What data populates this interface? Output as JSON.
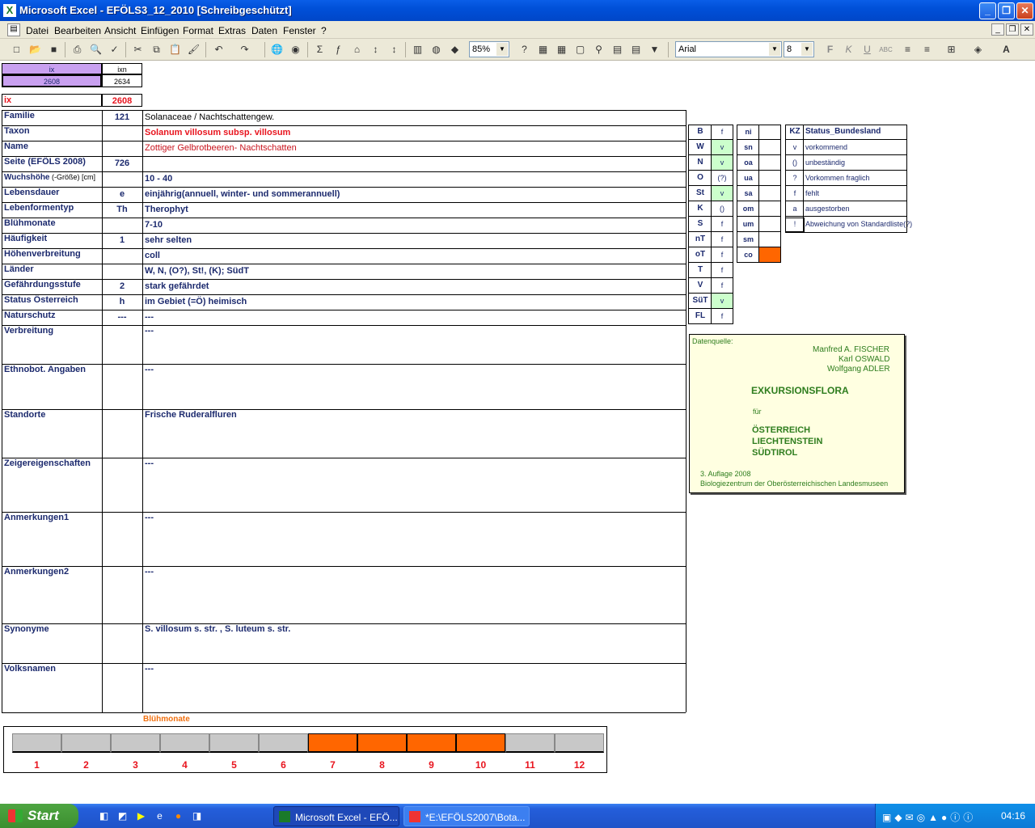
{
  "window": {
    "title": "Microsoft Excel - EFÖLS3_12_2010  [Schreibgeschützt]"
  },
  "menu": [
    "Datei",
    "Bearbeiten",
    "Ansicht",
    "Einfügen",
    "Format",
    "Extras",
    "Daten",
    "Fenster",
    "?"
  ],
  "toolbar": {
    "zoom": "85%",
    "font": "Arial",
    "size": "8"
  },
  "header_cells": {
    "ix_label": "ix",
    "ixn_label": "ixn",
    "ix_value": "2608",
    "ixn_value": "2634",
    "ix2_label": "ix",
    "ix2_value": "2608"
  },
  "rows": [
    {
      "label": "Familie",
      "code": "121",
      "value": "Solanaceae  /  Nachtschattengew."
    },
    {
      "label": "Taxon",
      "code": "",
      "value": "Solanum villosum subsp. villosum"
    },
    {
      "label": "Name",
      "code": "",
      "value": "Zottiger Gelbrotbeeren- Nachtschatten"
    },
    {
      "label": "Seite (EFÖLS 2008)",
      "code": "726",
      "value": ""
    },
    {
      "label": "Wuchshöhe",
      "label_suffix": "(-Größe) [cm]",
      "code": "",
      "value": " 10 - 40"
    },
    {
      "label": "Lebensdauer",
      "code": "e",
      "value": "einjährig(annuell, winter- und sommerannuell)"
    },
    {
      "label": "Lebenformentyp",
      "code": "Th",
      "value": "Therophyt"
    },
    {
      "label": "Blühmonate",
      "code": "",
      "value": " 7-10"
    },
    {
      "label": "Häufigkeit",
      "code": "1",
      "value": "sehr selten"
    },
    {
      "label": "Höhenverbreitung",
      "code": "",
      "value": "coll"
    },
    {
      "label": "Länder",
      "code": "",
      "value": "W, N, (O?), St!, (K); SüdT"
    },
    {
      "label": "Gefährdungsstufe",
      "code": "2",
      "value": "stark gefährdet"
    },
    {
      "label": "Status Österreich",
      "code": "h",
      "value": "im Gebiet (=Ö) heimisch"
    },
    {
      "label": "Naturschutz",
      "code": "---",
      "value": "---"
    },
    {
      "label": "Verbreitung",
      "code": "",
      "value": " ---"
    },
    {
      "label": "Ethnobot. Angaben",
      "code": "",
      "value": "---"
    },
    {
      "label": "Standorte",
      "code": "",
      "value": "Frische Ruderalfluren"
    },
    {
      "label": "Zeigereigenschaften",
      "code": "",
      "value": "---"
    },
    {
      "label": "Anmerkungen1",
      "code": "",
      "value": "---"
    },
    {
      "label": "Anmerkungen2",
      "code": "",
      "value": "---"
    },
    {
      "label": "Synonyme",
      "code": "",
      "value": "S. villosum s. str. , S. luteum s. str."
    },
    {
      "label": "Volksnamen",
      "code": "",
      "value": "---"
    }
  ],
  "states": [
    {
      "k": "B",
      "v": "f"
    },
    {
      "k": "W",
      "v": "v"
    },
    {
      "k": "N",
      "v": "v"
    },
    {
      "k": "O",
      "v": "(?)"
    },
    {
      "k": "St",
      "v": "v"
    },
    {
      "k": "K",
      "v": "()"
    },
    {
      "k": "S",
      "v": "f"
    },
    {
      "k": "nT",
      "v": "f"
    },
    {
      "k": "oT",
      "v": "f"
    },
    {
      "k": "T",
      "v": "f"
    },
    {
      "k": "V",
      "v": "f"
    },
    {
      "k": "SüT",
      "v": "v"
    },
    {
      "k": "FL",
      "v": "f"
    }
  ],
  "altitudes": [
    "ni",
    "sn",
    "oa",
    "ua",
    "sa",
    "om",
    "um",
    "sm",
    "co"
  ],
  "legend": {
    "kz": "KZ",
    "title": "Status_Bundesland",
    "items": [
      {
        "k": "v",
        "t": "vorkommend"
      },
      {
        "k": "()",
        "t": "unbeständig"
      },
      {
        "k": "?",
        "t": "Vorkommen fraglich"
      },
      {
        "k": "f",
        "t": "fehlt"
      },
      {
        "k": "a",
        "t": "ausgestorben"
      },
      {
        "k": "!",
        "t": "Abweichung von Standardliste(?)"
      }
    ]
  },
  "source": {
    "label": "Datenquelle:",
    "authors": [
      "Manfred A. FISCHER",
      "Karl OSWALD",
      "Wolfgang ADLER"
    ],
    "book": "EXKURSIONSFLORA",
    "fuer": "für",
    "countries": [
      "ÖSTERREICH",
      "LIECHTENSTEIN",
      "SÜDTIROL"
    ],
    "edition": "3. Auflage 2008",
    "publisher": "Biologiezentrum der Oberösterreichischen Landesmuseen"
  },
  "bloom": {
    "title": "Blühmonate",
    "months": [
      "1",
      "2",
      "3",
      "4",
      "5",
      "6",
      "7",
      "8",
      "9",
      "10",
      "11",
      "12"
    ],
    "active": [
      7,
      8,
      9,
      10
    ]
  },
  "taskbar": {
    "start": "Start",
    "task1": "Microsoft Excel - EFÖ...",
    "task2": "*E:\\EFÖLS2007\\Bota...",
    "clock": "04:16"
  },
  "colors": {
    "orange": "#ff6600",
    "lilac": "#c9a0f0",
    "green": "#ccffcc"
  }
}
